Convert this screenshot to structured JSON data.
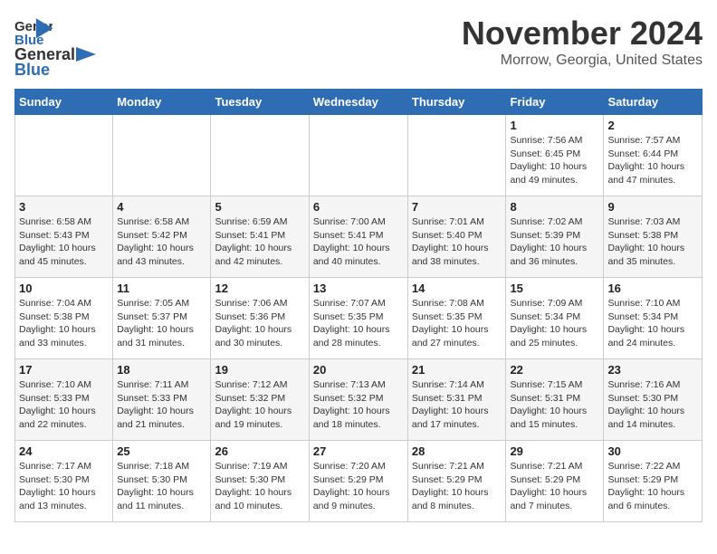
{
  "header": {
    "logo_line1": "General",
    "logo_line2": "Blue",
    "month": "November 2024",
    "location": "Morrow, Georgia, United States"
  },
  "days_of_week": [
    "Sunday",
    "Monday",
    "Tuesday",
    "Wednesday",
    "Thursday",
    "Friday",
    "Saturday"
  ],
  "weeks": [
    [
      {
        "day": "",
        "info": ""
      },
      {
        "day": "",
        "info": ""
      },
      {
        "day": "",
        "info": ""
      },
      {
        "day": "",
        "info": ""
      },
      {
        "day": "",
        "info": ""
      },
      {
        "day": "1",
        "info": "Sunrise: 7:56 AM\nSunset: 6:45 PM\nDaylight: 10 hours\nand 49 minutes."
      },
      {
        "day": "2",
        "info": "Sunrise: 7:57 AM\nSunset: 6:44 PM\nDaylight: 10 hours\nand 47 minutes."
      }
    ],
    [
      {
        "day": "3",
        "info": "Sunrise: 6:58 AM\nSunset: 5:43 PM\nDaylight: 10 hours\nand 45 minutes."
      },
      {
        "day": "4",
        "info": "Sunrise: 6:58 AM\nSunset: 5:42 PM\nDaylight: 10 hours\nand 43 minutes."
      },
      {
        "day": "5",
        "info": "Sunrise: 6:59 AM\nSunset: 5:41 PM\nDaylight: 10 hours\nand 42 minutes."
      },
      {
        "day": "6",
        "info": "Sunrise: 7:00 AM\nSunset: 5:41 PM\nDaylight: 10 hours\nand 40 minutes."
      },
      {
        "day": "7",
        "info": "Sunrise: 7:01 AM\nSunset: 5:40 PM\nDaylight: 10 hours\nand 38 minutes."
      },
      {
        "day": "8",
        "info": "Sunrise: 7:02 AM\nSunset: 5:39 PM\nDaylight: 10 hours\nand 36 minutes."
      },
      {
        "day": "9",
        "info": "Sunrise: 7:03 AM\nSunset: 5:38 PM\nDaylight: 10 hours\nand 35 minutes."
      }
    ],
    [
      {
        "day": "10",
        "info": "Sunrise: 7:04 AM\nSunset: 5:38 PM\nDaylight: 10 hours\nand 33 minutes."
      },
      {
        "day": "11",
        "info": "Sunrise: 7:05 AM\nSunset: 5:37 PM\nDaylight: 10 hours\nand 31 minutes."
      },
      {
        "day": "12",
        "info": "Sunrise: 7:06 AM\nSunset: 5:36 PM\nDaylight: 10 hours\nand 30 minutes."
      },
      {
        "day": "13",
        "info": "Sunrise: 7:07 AM\nSunset: 5:35 PM\nDaylight: 10 hours\nand 28 minutes."
      },
      {
        "day": "14",
        "info": "Sunrise: 7:08 AM\nSunset: 5:35 PM\nDaylight: 10 hours\nand 27 minutes."
      },
      {
        "day": "15",
        "info": "Sunrise: 7:09 AM\nSunset: 5:34 PM\nDaylight: 10 hours\nand 25 minutes."
      },
      {
        "day": "16",
        "info": "Sunrise: 7:10 AM\nSunset: 5:34 PM\nDaylight: 10 hours\nand 24 minutes."
      }
    ],
    [
      {
        "day": "17",
        "info": "Sunrise: 7:10 AM\nSunset: 5:33 PM\nDaylight: 10 hours\nand 22 minutes."
      },
      {
        "day": "18",
        "info": "Sunrise: 7:11 AM\nSunset: 5:33 PM\nDaylight: 10 hours\nand 21 minutes."
      },
      {
        "day": "19",
        "info": "Sunrise: 7:12 AM\nSunset: 5:32 PM\nDaylight: 10 hours\nand 19 minutes."
      },
      {
        "day": "20",
        "info": "Sunrise: 7:13 AM\nSunset: 5:32 PM\nDaylight: 10 hours\nand 18 minutes."
      },
      {
        "day": "21",
        "info": "Sunrise: 7:14 AM\nSunset: 5:31 PM\nDaylight: 10 hours\nand 17 minutes."
      },
      {
        "day": "22",
        "info": "Sunrise: 7:15 AM\nSunset: 5:31 PM\nDaylight: 10 hours\nand 15 minutes."
      },
      {
        "day": "23",
        "info": "Sunrise: 7:16 AM\nSunset: 5:30 PM\nDaylight: 10 hours\nand 14 minutes."
      }
    ],
    [
      {
        "day": "24",
        "info": "Sunrise: 7:17 AM\nSunset: 5:30 PM\nDaylight: 10 hours\nand 13 minutes."
      },
      {
        "day": "25",
        "info": "Sunrise: 7:18 AM\nSunset: 5:30 PM\nDaylight: 10 hours\nand 11 minutes."
      },
      {
        "day": "26",
        "info": "Sunrise: 7:19 AM\nSunset: 5:30 PM\nDaylight: 10 hours\nand 10 minutes."
      },
      {
        "day": "27",
        "info": "Sunrise: 7:20 AM\nSunset: 5:29 PM\nDaylight: 10 hours\nand 9 minutes."
      },
      {
        "day": "28",
        "info": "Sunrise: 7:21 AM\nSunset: 5:29 PM\nDaylight: 10 hours\nand 8 minutes."
      },
      {
        "day": "29",
        "info": "Sunrise: 7:21 AM\nSunset: 5:29 PM\nDaylight: 10 hours\nand 7 minutes."
      },
      {
        "day": "30",
        "info": "Sunrise: 7:22 AM\nSunset: 5:29 PM\nDaylight: 10 hours\nand 6 minutes."
      }
    ]
  ]
}
